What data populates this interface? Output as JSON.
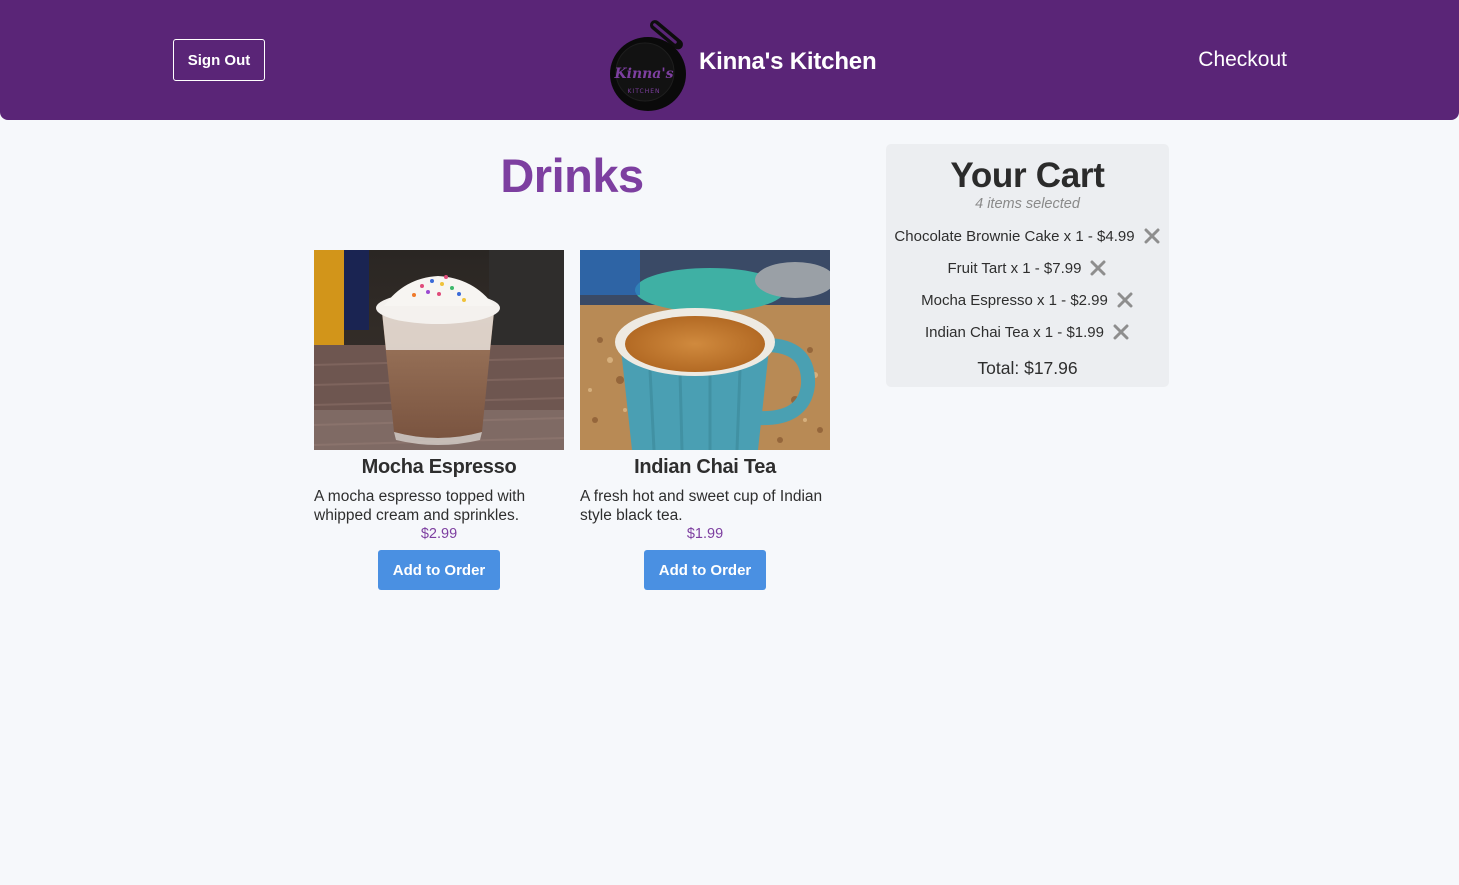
{
  "header": {
    "sign_out_label": "Sign Out",
    "brand_name": "Kinna's Kitchen",
    "logo_text": "Kinna's",
    "logo_subtext": "KITCHEN",
    "checkout_label": "Checkout",
    "background_color": "#5a2577"
  },
  "main": {
    "section_title": "Drinks",
    "products": [
      {
        "name": "Mocha Espresso",
        "description": "A mocha espresso topped with whipped cream and sprinkles.",
        "price": "$2.99",
        "button_label": "Add to Order",
        "image": "iced-mocha-with-whipped-cream-photo"
      },
      {
        "name": "Indian Chai Tea",
        "description": "A fresh hot and sweet cup of Indian style black tea.",
        "price": "$1.99",
        "button_label": "Add to Order",
        "image": "chai-tea-in-blue-mug-photo"
      }
    ]
  },
  "cart": {
    "title": "Your Cart",
    "subtitle": "4 items selected",
    "items": [
      {
        "label": "Chocolate Brownie Cake x 1 - $4.99",
        "remove_icon": "close-x-icon"
      },
      {
        "label": "Fruit Tart x 1 - $7.99",
        "remove_icon": "close-x-icon"
      },
      {
        "label": "Mocha Espresso x 1 - $2.99",
        "remove_icon": "close-x-icon"
      },
      {
        "label": "Indian Chai Tea x 1 - $1.99",
        "remove_icon": "close-x-icon"
      }
    ],
    "total": "Total: $17.96"
  },
  "colors": {
    "accent_purple": "#7d3fa0",
    "button_blue": "#4a90e2",
    "page_background": "#f6f8fb",
    "cart_background": "#eceef1"
  }
}
